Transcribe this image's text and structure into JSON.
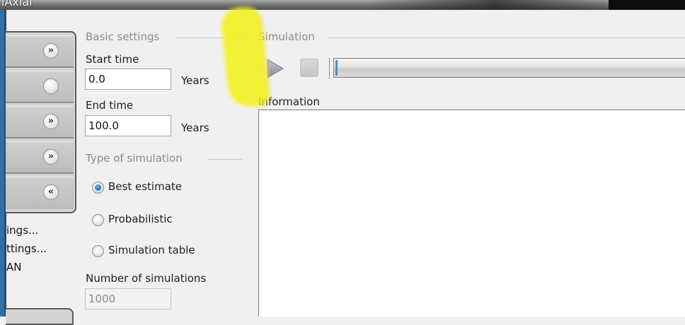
{
  "window": {
    "title": "iAxial"
  },
  "left_panel": {
    "nav_buttons": [
      {
        "icon": "double-chevron-down"
      },
      {
        "icon": "circle"
      },
      {
        "icon": "double-chevron-down"
      },
      {
        "icon": "double-chevron-down"
      },
      {
        "icon": "double-chevron-up"
      }
    ],
    "links": [
      "ings...",
      "ttings...",
      "AN"
    ]
  },
  "basic_settings": {
    "title": "Basic settings",
    "start_time_label": "Start time",
    "start_time_value": "0.0",
    "start_time_unit": "Years",
    "end_time_label": "End time",
    "end_time_value": "100.0",
    "end_time_unit": "Years"
  },
  "simulation_type": {
    "title": "Type of simulation",
    "options": [
      {
        "label": "Best estimate",
        "checked": true
      },
      {
        "label": "Probabilistic",
        "checked": false
      },
      {
        "label": "Simulation table",
        "checked": false
      }
    ],
    "num_simulations_label": "Number of simulations",
    "num_simulations_value": "1000"
  },
  "simulation": {
    "title": "Simulation",
    "information_label": "Information",
    "progress_fraction": 0.0
  },
  "colors": {
    "highlight": "#f0f014",
    "radio_checked": "#1d6fc0"
  }
}
